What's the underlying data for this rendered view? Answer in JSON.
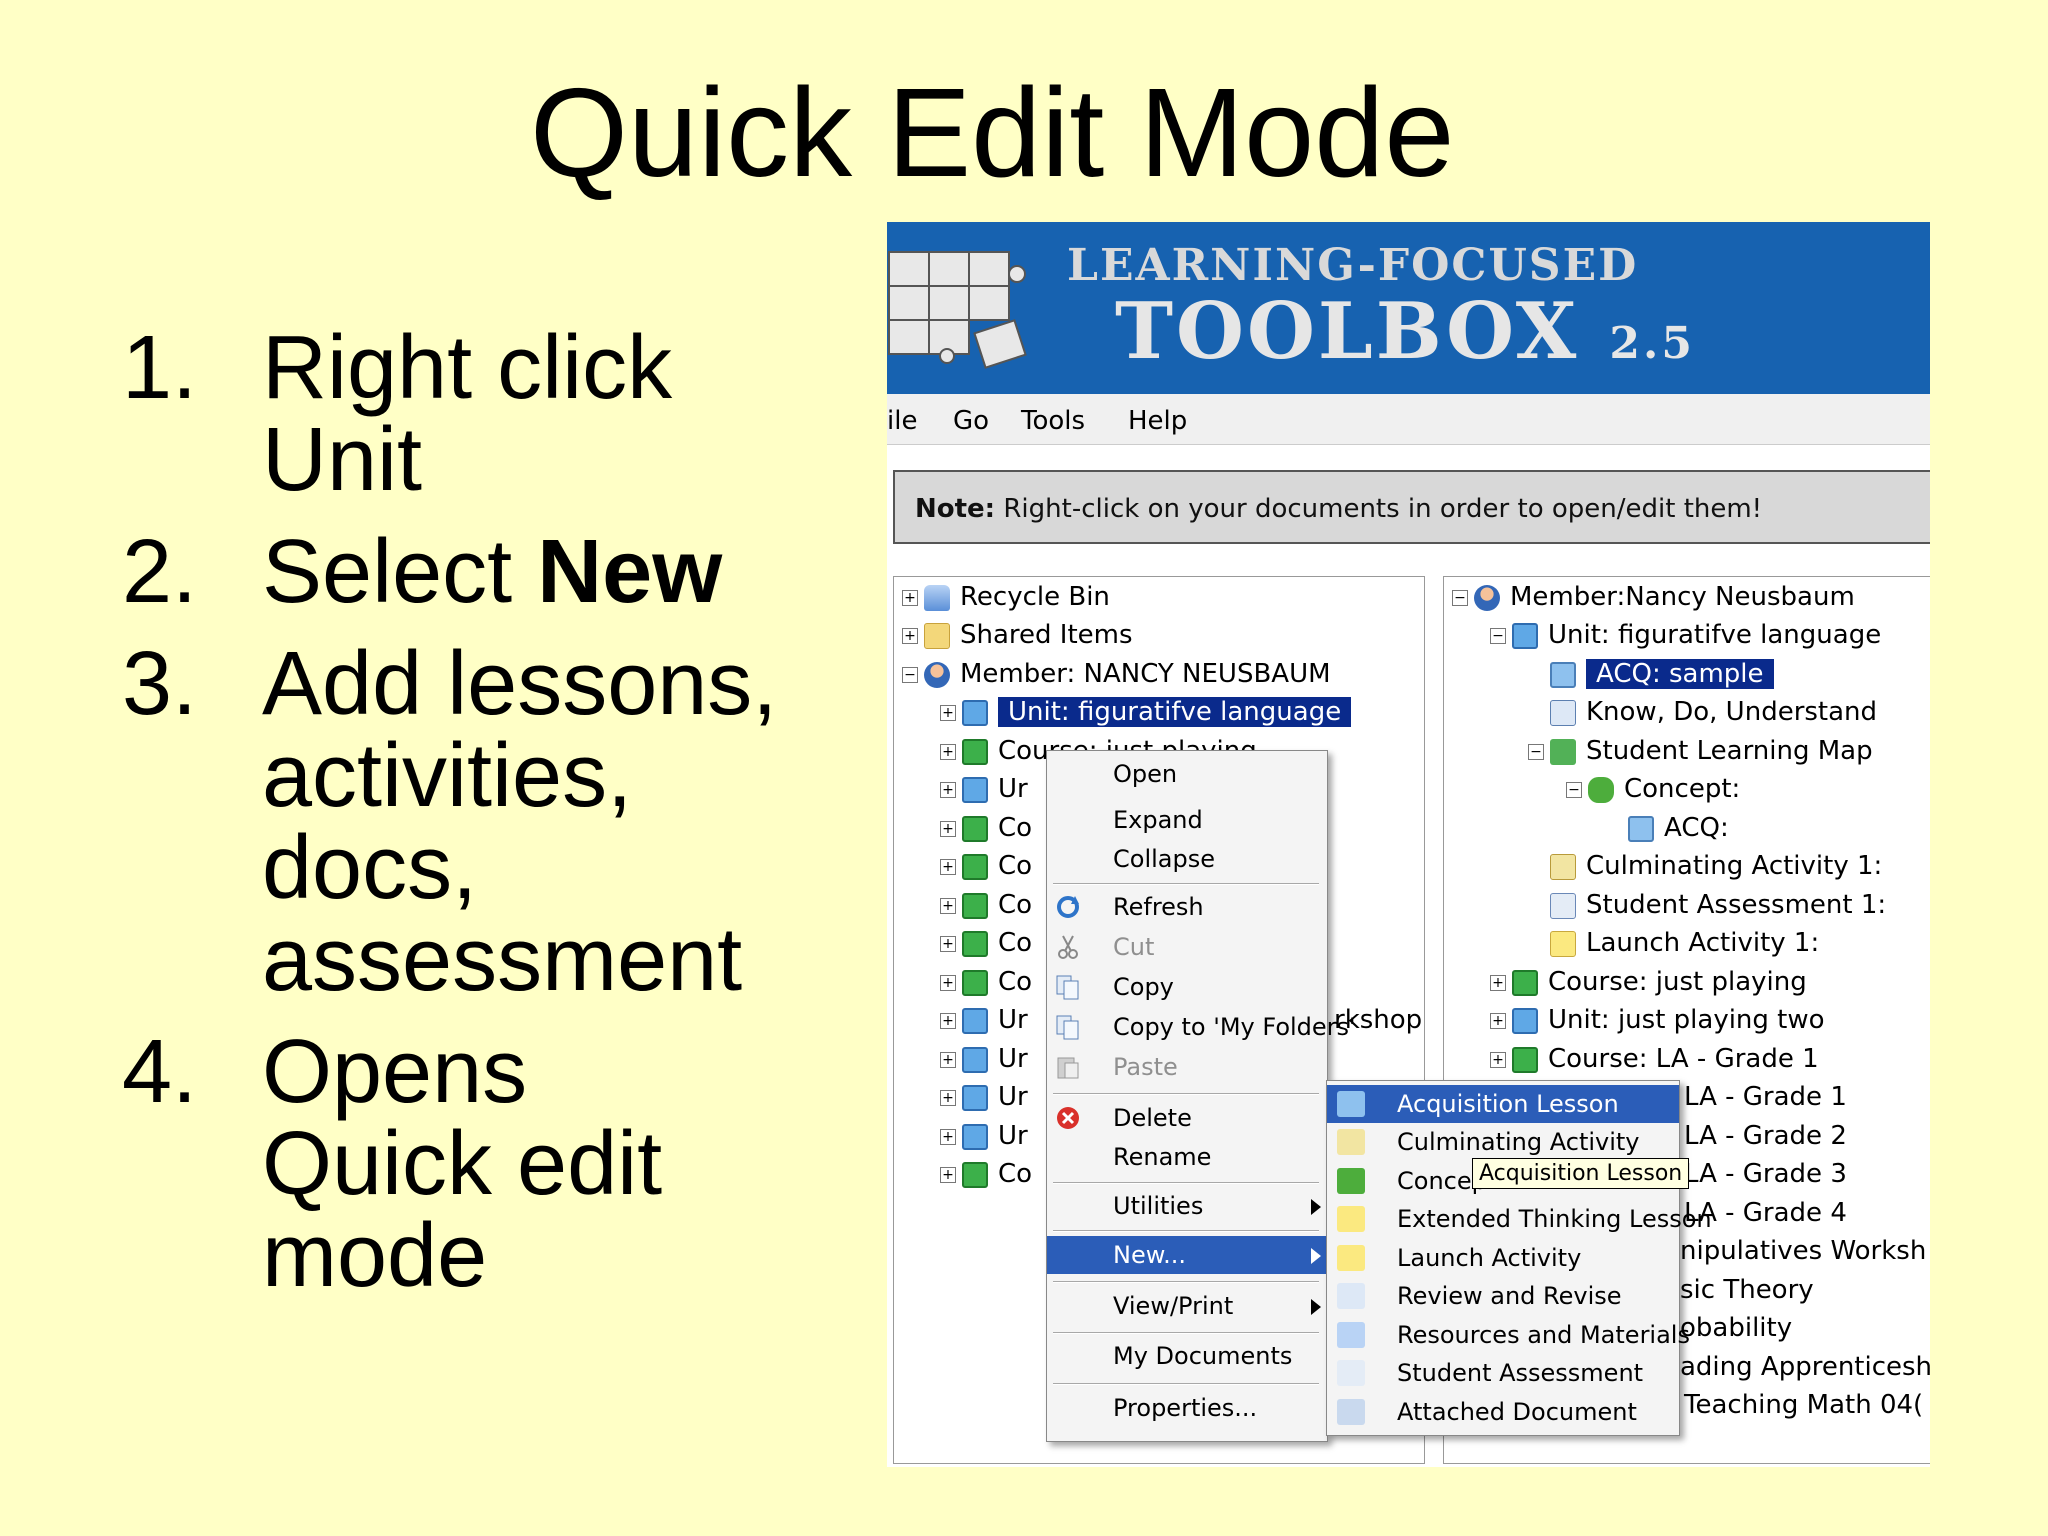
{
  "slide": {
    "title": "Quick Edit Mode",
    "steps": [
      {
        "num": "1.",
        "lines": [
          "Right click",
          "Unit"
        ]
      },
      {
        "num": "2.",
        "text_before": "Select ",
        "bold": "New"
      },
      {
        "num": "3.",
        "lines": [
          "Add lessons,",
          "activities,",
          "docs,",
          "assessment"
        ]
      },
      {
        "num": "4.",
        "lines": [
          "Opens",
          "Quick edit",
          "mode"
        ]
      }
    ]
  },
  "app": {
    "brand_line1": "LEARNING-FOCUSED",
    "brand_line2": "TOOLBOX",
    "brand_version": "2.5",
    "menu": [
      "ile",
      "Go",
      "Tools",
      "Help"
    ],
    "note_label": "Note:",
    "note_text": " Right-click on your documents in order to open/edit them!",
    "left_tree": [
      {
        "label": "Recycle Bin",
        "icon": "recycle-bin-icon"
      },
      {
        "label": "Shared Items",
        "icon": "folder-icon"
      },
      {
        "label": "Member: NANCY NEUSBAUM",
        "icon": "member-icon"
      },
      {
        "label": "Unit: figuratifve language",
        "icon": "unit-icon",
        "selected": true
      },
      {
        "label": "Course: just playing",
        "icon": "course-icon"
      },
      {
        "label": "Ur",
        "icon": "unit-icon"
      },
      {
        "label": "Co",
        "icon": "course-icon"
      },
      {
        "label": "Co",
        "icon": "course-icon"
      },
      {
        "label": "Co",
        "icon": "course-icon"
      },
      {
        "label": "Co",
        "icon": "course-icon"
      },
      {
        "label": "Co",
        "icon": "course-icon"
      },
      {
        "label": "Ur",
        "icon": "unit-icon"
      },
      {
        "label": "Ur",
        "icon": "unit-icon"
      },
      {
        "label": "Ur",
        "icon": "unit-icon"
      },
      {
        "label": "Ur",
        "icon": "unit-icon"
      },
      {
        "label": "Co",
        "icon": "course-icon"
      }
    ],
    "left_overflow_text": "rkshop",
    "right_tree": [
      {
        "label": "Member:Nancy Neusbaum",
        "icon": "member-icon"
      },
      {
        "label": "Unit: figuratifve language",
        "icon": "unit-icon"
      },
      {
        "label": "ACQ: sample",
        "icon": "acq-icon",
        "selected": true
      },
      {
        "label": "Know, Do, Understand",
        "icon": "kdu-icon"
      },
      {
        "label": "Student Learning Map",
        "icon": "map-icon"
      },
      {
        "label": "Concept:",
        "icon": "concept-icon"
      },
      {
        "label": "ACQ:",
        "icon": "acq-icon"
      },
      {
        "label": "Culminating Activity 1:",
        "icon": "document-icon"
      },
      {
        "label": "Student Assessment 1:",
        "icon": "assessment-icon"
      },
      {
        "label": "Launch Activity 1:",
        "icon": "launch-icon"
      },
      {
        "label": "Course: just playing",
        "icon": "course-icon"
      },
      {
        "label": "Unit: just playing two",
        "icon": "unit-icon"
      },
      {
        "label": "Course: LA - Grade 1",
        "icon": "course-icon"
      }
    ],
    "right_tail": [
      "LA - Grade 1",
      "LA - Grade 2",
      "LA - Grade 3",
      "LA - Grade 4",
      "nipulatives Worksh",
      "sic Theory",
      "obability",
      "ading Apprenticesh",
      "Teaching Math 04("
    ],
    "context_menu": {
      "open": "Open",
      "expand": "Expand",
      "collapse": "Collapse",
      "refresh": "Refresh",
      "cut": "Cut",
      "copy": "Copy",
      "copy_to": "Copy to 'My Folders'",
      "paste": "Paste",
      "delete": "Delete",
      "rename": "Rename",
      "utilities": "Utilities",
      "new": "New...",
      "view_print": "View/Print",
      "my_documents": "My Documents",
      "properties": "Properties..."
    },
    "new_submenu": [
      {
        "label": "Acquisition Lesson",
        "color": "#8EC1EE"
      },
      {
        "label": "Culminating Activity",
        "color": "#F2E5A2"
      },
      {
        "label": "Concep",
        "color": "#4DAD3C"
      },
      {
        "label": "Extended Thinking Lesson",
        "color": "#FBE980"
      },
      {
        "label": "Launch Activity",
        "color": "#FBE980"
      },
      {
        "label": "Review and Revise",
        "color": "#DDE8F6"
      },
      {
        "label": "Resources and Materials",
        "color": "#B9D3F5"
      },
      {
        "label": "Student Assessment",
        "color": "#E4ECF6"
      },
      {
        "label": "Attached Document",
        "color": "#C9D9EE"
      }
    ],
    "tooltip": "Acquisition Lesson",
    "colors": {
      "banner": "#1762B0",
      "selection": "#0A2A8C",
      "menu_highlight": "#2B5DB8",
      "slide_bg": "#FFFFC6"
    }
  }
}
